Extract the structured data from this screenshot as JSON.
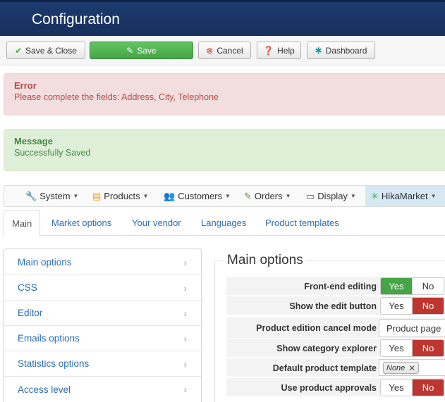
{
  "header": {
    "title": "Configuration"
  },
  "toolbar": {
    "save_close": "Save & Close",
    "save": "Save",
    "cancel": "Cancel",
    "help": "Help",
    "dashboard": "Dashboard"
  },
  "alerts": {
    "error": {
      "title": "Error",
      "text": "Please complete the fields: Address, City, Telephone"
    },
    "message": {
      "title": "Message",
      "text": "Successfully Saved"
    }
  },
  "menu": {
    "system": "System",
    "products": "Products",
    "customers": "Customers",
    "orders": "Orders",
    "display": "Display",
    "hikamarket": "HikaMarket"
  },
  "tabs": {
    "main": "Main",
    "market_options": "Market options",
    "your_vendor": "Your vendor",
    "languages": "Languages",
    "product_templates": "Product templates"
  },
  "sidebar": {
    "items": [
      "Main options",
      "CSS",
      "Editor",
      "Emails options",
      "Statistics options",
      "Access level"
    ]
  },
  "main_options": {
    "legend": "Main options",
    "yes": "Yes",
    "no": "No",
    "front_end_editing": "Front-end editing",
    "show_edit_button": "Show the edit button",
    "product_edition_cancel_mode": "Product edition cancel mode",
    "product_edition_cancel_value": "Product page",
    "show_category_explorer": "Show category explorer",
    "default_product_template": "Default product template",
    "default_product_template_value": "None",
    "use_product_approvals": "Use product approvals"
  },
  "colors": {
    "header": "#17305c",
    "yes_active": "#46a546",
    "no_active": "#bd362f",
    "link": "#2a6eb4"
  }
}
